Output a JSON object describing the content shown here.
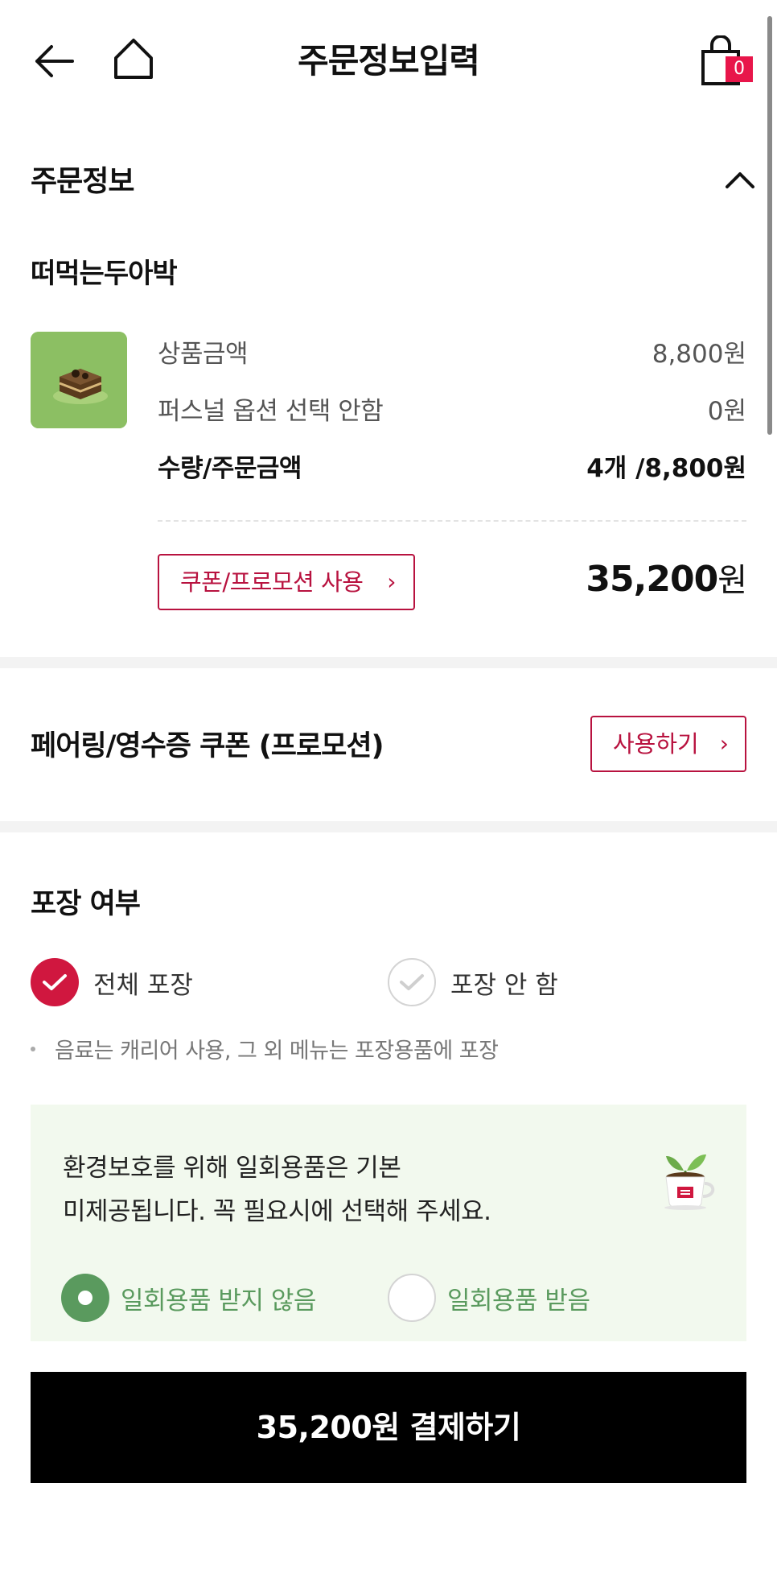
{
  "header": {
    "title": "주문정보입력",
    "cart_count": "0"
  },
  "order_info": {
    "section_title": "주문정보",
    "product": {
      "name": "떠먹는두아박",
      "rows": [
        {
          "label": "상품금액",
          "value": "8,800원"
        },
        {
          "label": "퍼스널 옵션 선택 안함",
          "value": "0원"
        },
        {
          "label": "수량/주문금액",
          "value": "4개 /8,800원"
        }
      ]
    },
    "coupon_button": "쿠폰/프로모션 사용",
    "total_amount": "35,200",
    "total_unit": "원"
  },
  "pairing": {
    "title": "페어링/영수증 쿠폰 (프로모션)",
    "use_button": "사용하기"
  },
  "packaging": {
    "title": "포장 여부",
    "options": [
      {
        "label": "전체 포장",
        "selected": true
      },
      {
        "label": "포장 안 함",
        "selected": false
      }
    ],
    "note": "음료는 캐리어 사용, 그 외 메뉴는 포장용품에 포장"
  },
  "eco": {
    "line1": "환경보호를 위해 일회용품은 기본",
    "line2": "미제공됩니다. 꼭 필요시에 선택해 주세요.",
    "options": [
      {
        "label": "일회용품 받지 않음",
        "selected": true
      },
      {
        "label": "일회용품 받음",
        "selected": false
      }
    ]
  },
  "pay_button": "35,200원 결제하기",
  "colors": {
    "accent": "#b8123f",
    "check": "#d0173f",
    "eco_green": "#5a9a5e",
    "eco_bg": "#f2f9ee",
    "badge": "#e8164a"
  }
}
